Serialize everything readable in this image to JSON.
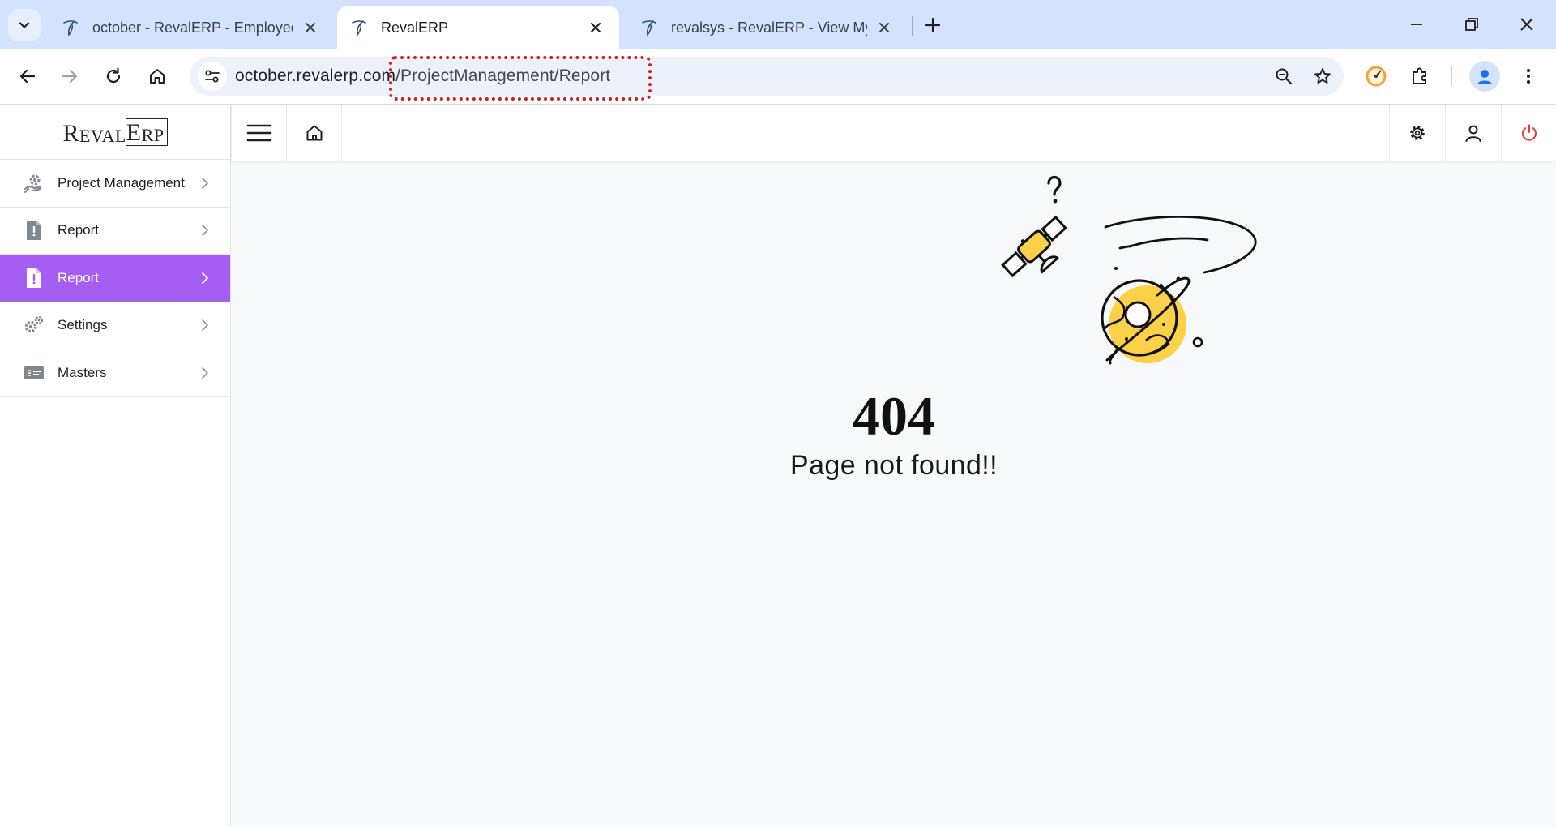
{
  "browser": {
    "tabs": [
      {
        "title": "october - RevalERP - Employee",
        "active": false
      },
      {
        "title": "RevalERP",
        "active": true
      },
      {
        "title": "revalsys - RevalERP - View My T",
        "active": false
      }
    ],
    "url": {
      "host": "october.revalerp.com",
      "path": "/ProjectManagement/Report"
    }
  },
  "brand": {
    "r": "R",
    "eval": "EVAL",
    "e": "E",
    "rp": "RP"
  },
  "sidebar": {
    "items": [
      {
        "label": "Project Management",
        "icon": "gear-hand-icon",
        "active": false
      },
      {
        "label": "Report",
        "icon": "report-file-icon",
        "active": false
      },
      {
        "label": "Report",
        "icon": "report-file-icon",
        "active": true
      },
      {
        "label": "Settings",
        "icon": "gears-icon",
        "active": false
      },
      {
        "label": "Masters",
        "icon": "masters-card-icon",
        "active": false
      }
    ]
  },
  "error": {
    "code": "404",
    "message": "Page not found!!"
  },
  "colors": {
    "accent": "#a65ef2",
    "power": "#e53935",
    "illustration": "#fdd04a"
  }
}
